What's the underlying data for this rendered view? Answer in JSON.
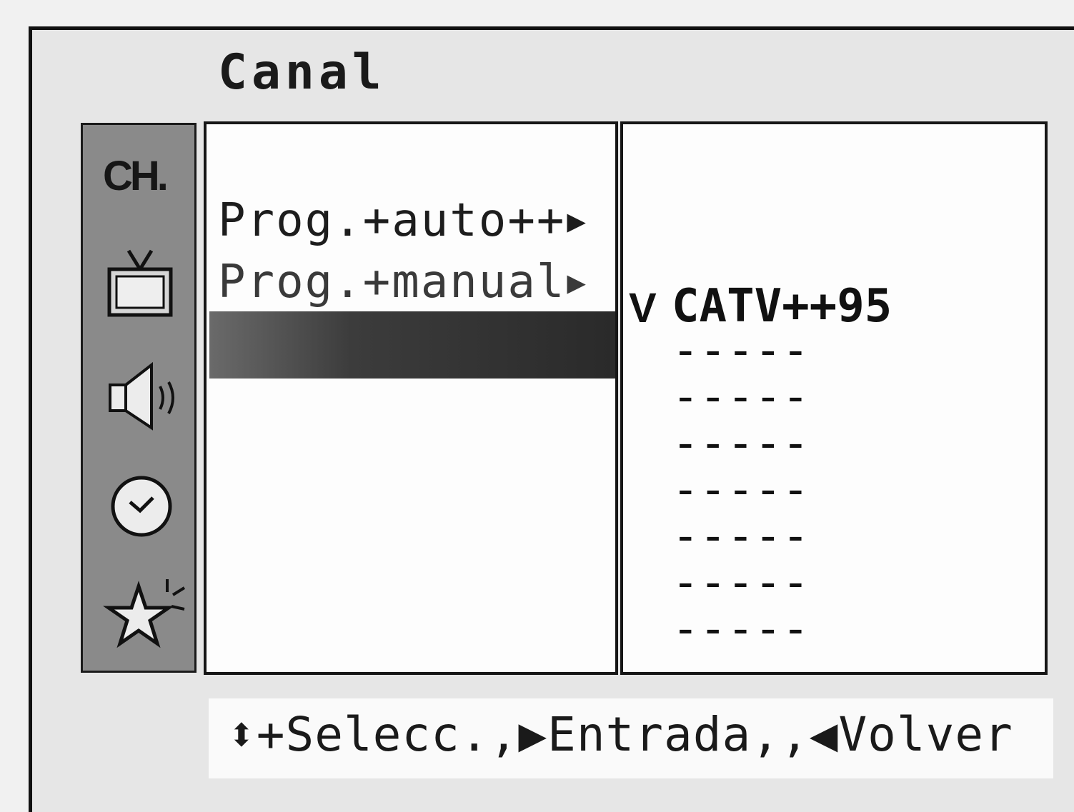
{
  "menu": {
    "title": "Canal",
    "sidebar": {
      "items": [
        {
          "label": "CH.",
          "icon": "ch-icon",
          "active": true
        },
        {
          "icon": "tv-icon"
        },
        {
          "icon": "speaker-icon"
        },
        {
          "icon": "clock-icon"
        },
        {
          "icon": "star-icon"
        }
      ]
    },
    "options": [
      {
        "label": "Prog.+auto++",
        "arrow": "▶"
      },
      {
        "label": "Prog.+manual",
        "arrow": "▶"
      }
    ],
    "channels": {
      "check_mark": "V",
      "entries": [
        "CATV++95",
        "-----",
        "-----",
        "-----",
        "-----",
        "-----",
        "-----",
        "-----"
      ]
    },
    "help": {
      "text": "⬍+Selecc.,▶Entrada,,◀Volver"
    },
    "colors": {
      "background": "#e6e6e6",
      "sidebar": "#8a8a8a",
      "panel": "#fdfdfd",
      "highlight": "#2a2a2a",
      "text": "#1a1a1a"
    }
  }
}
